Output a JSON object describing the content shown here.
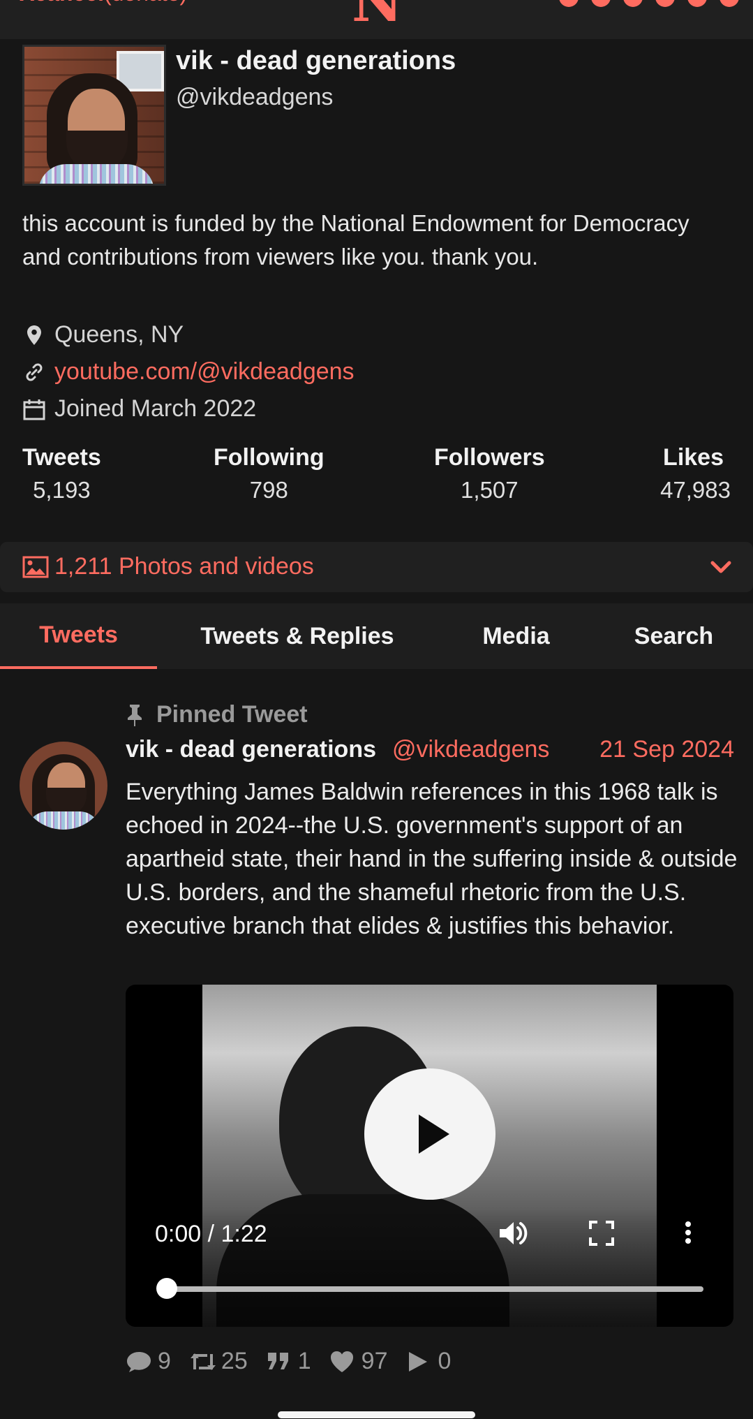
{
  "topbar": {
    "brand": "Xcancel",
    "brand_sub": "(donate)",
    "logo": "N"
  },
  "profile": {
    "fullname": "vik - dead generations",
    "handle": "@vikdeadgens",
    "bio": "this account is funded by the National Endowment for Democracy and contributions from viewers like you. thank you.",
    "location": "Queens, NY",
    "website": "youtube.com/@vikdeadgens",
    "joined": "Joined March 2022",
    "stats": [
      {
        "label": "Tweets",
        "value": "5,193"
      },
      {
        "label": "Following",
        "value": "798"
      },
      {
        "label": "Followers",
        "value": "1,507"
      },
      {
        "label": "Likes",
        "value": "47,983"
      }
    ]
  },
  "photos_bar": {
    "label": "1,211 Photos and videos"
  },
  "tabs": [
    {
      "label": "Tweets",
      "active": true
    },
    {
      "label": "Tweets & Replies"
    },
    {
      "label": "Media"
    },
    {
      "label": "Search"
    }
  ],
  "tweet": {
    "pinned_label": "Pinned Tweet",
    "name": "vik - dead generations",
    "handle": "@vikdeadgens",
    "date": "21 Sep 2024",
    "text": "Everything James Baldwin references in this 1968 talk is echoed in 2024--the U.S. government's support of an apartheid state, their hand in the suffering inside & outside U.S. borders, and the shameful rhetoric from the U.S. executive branch that elides & justifies this behavior.",
    "video": {
      "time": "0:00 / 1:22",
      "progress": 0
    },
    "stats": {
      "replies": "9",
      "retweets": "25",
      "quotes": "1",
      "likes": "97",
      "plays": "0"
    }
  },
  "colors": {
    "accent": "#ff6c60",
    "background": "#161616",
    "panel": "#202020"
  }
}
